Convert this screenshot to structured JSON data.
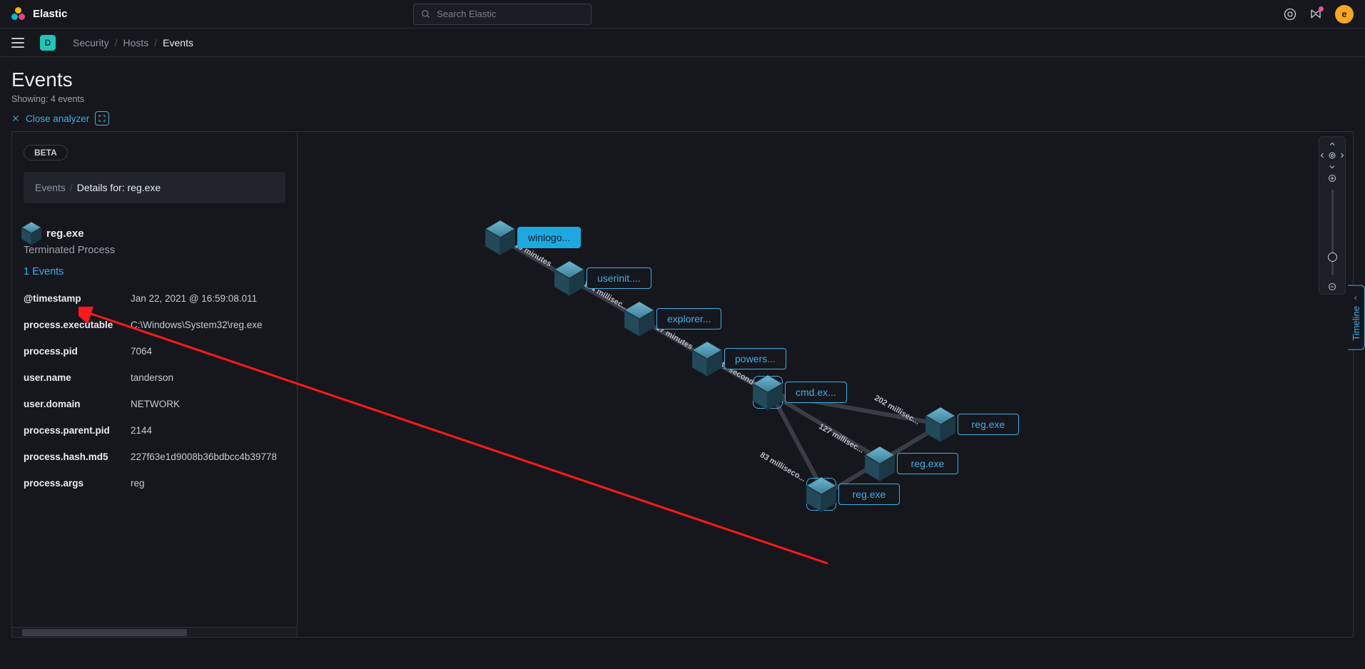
{
  "brand": "Elastic",
  "search_placeholder": "Search Elastic",
  "avatar_letter": "e",
  "space_letter": "D",
  "breadcrumbs": {
    "a": "Security",
    "b": "Hosts",
    "c": "Events"
  },
  "page": {
    "title": "Events",
    "subtitle": "Showing: 4 events"
  },
  "close_analyzer": "Close analyzer",
  "beta": "BETA",
  "panel_crumb": {
    "a": "Events",
    "b": "Details for: reg.exe"
  },
  "process": {
    "name": "reg.exe",
    "status": "Terminated Process",
    "events_link": "1 Events"
  },
  "fields": [
    {
      "k": "@timestamp",
      "v": "Jan 22, 2021 @ 16:59:08.011"
    },
    {
      "k": "process.executable",
      "v": "C:\\Windows\\System32\\reg.exe"
    },
    {
      "k": "process.pid",
      "v": "7064"
    },
    {
      "k": "user.name",
      "v": "tanderson"
    },
    {
      "k": "user.domain",
      "v": "NETWORK"
    },
    {
      "k": "process.parent.pid",
      "v": "2144"
    },
    {
      "k": "process.hash.md5",
      "v": "227f63e1d9008b36bdbcc4b39778"
    },
    {
      "k": "process.args",
      "v": "reg"
    }
  ],
  "nodes": {
    "n0": "winlogo...",
    "n1": "userinit....",
    "n2": "explorer...",
    "n3": "powers...",
    "n4": "cmd.ex...",
    "n5": "reg.exe",
    "n6": "reg.exe",
    "n7": "reg.exe"
  },
  "edges": {
    "e0": "10 minutes",
    "e1": "184 millisec...",
    "e2": "17 minutes",
    "e3": "47 seconds",
    "e4": "202 millisec...",
    "e5": "127 millisec...",
    "e6": "83 milliseco..."
  },
  "timeline": "Timeline"
}
